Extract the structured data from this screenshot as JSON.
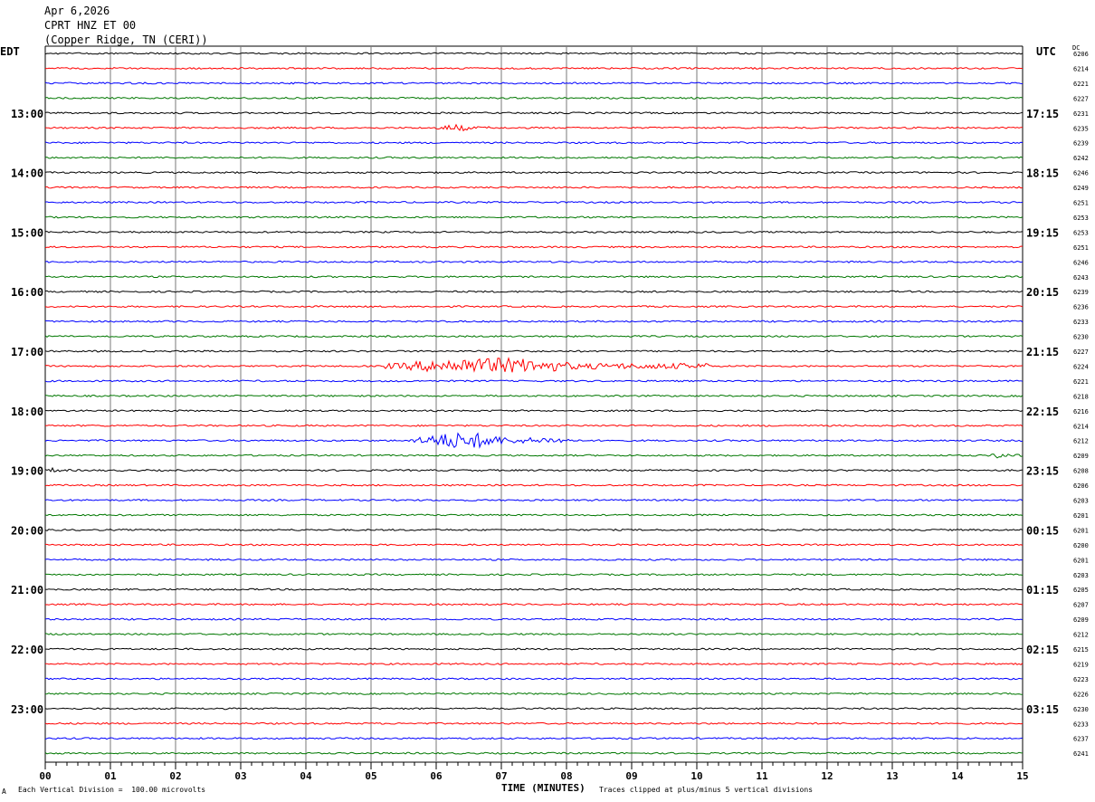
{
  "header": {
    "date": "Apr 6,2026",
    "station": "CPRT HNZ ET 00",
    "location": "(Copper Ridge, TN (CERI))"
  },
  "left_tz": "EDT",
  "right_tz": "UTC",
  "dc_label": "DC",
  "footer": {
    "mark": "A",
    "scale": "Each Vertical Division =  100.00 microvolts",
    "xlabel": "TIME (MINUTES)",
    "clip": "Traces clipped at plus/minus 5 vertical divisions"
  },
  "colors": {
    "cycle": [
      "#000000",
      "#ff0000",
      "#0000ff",
      "#007700"
    ],
    "grid": "#7a7a7a"
  },
  "chart_data": {
    "type": "line",
    "x_ticks": [
      "00",
      "01",
      "02",
      "03",
      "04",
      "05",
      "06",
      "07",
      "08",
      "09",
      "10",
      "11",
      "12",
      "13",
      "14",
      "15"
    ],
    "xlim": [
      0,
      15
    ],
    "left_hour_labels": [
      "13:00",
      "14:00",
      "15:00",
      "16:00",
      "17:00",
      "18:00",
      "19:00",
      "20:00",
      "21:00",
      "22:00",
      "23:00"
    ],
    "right_hour_labels": [
      "17:15",
      "18:15",
      "19:15",
      "20:15",
      "21:15",
      "22:15",
      "23:15",
      "00:15",
      "01:15",
      "02:15",
      "03:15"
    ],
    "dc_values": [
      "6206",
      "6214",
      "6221",
      "6227",
      "6231",
      "6235",
      "6239",
      "6242",
      "6246",
      "6249",
      "6251",
      "6253",
      "6253",
      "6251",
      "6246",
      "6243",
      "6239",
      "6236",
      "6233",
      "6230",
      "6227",
      "6224",
      "6221",
      "6218",
      "6216",
      "6214",
      "6212",
      "6209",
      "6208",
      "6206",
      "6203",
      "6201",
      "6201",
      "6200",
      "6201",
      "6203",
      "6205",
      "6207",
      "6209",
      "6212",
      "6215",
      "6219",
      "6223",
      "6226",
      "6230",
      "6233",
      "6237",
      "6241"
    ],
    "events": [
      {
        "trace": 5,
        "start_min": 6.0,
        "end_min": 6.9,
        "amplitude": 4
      },
      {
        "trace": 21,
        "start_min": 5.2,
        "end_min": 10.2,
        "amplitude": 9
      },
      {
        "trace": 26,
        "start_min": 5.6,
        "end_min": 8.1,
        "amplitude": 9
      },
      {
        "trace": 27,
        "start_min": 14.5,
        "end_min": 15.0,
        "amplitude": 4
      },
      {
        "trace": 28,
        "start_min": 0.0,
        "end_min": 0.5,
        "amplitude": 3
      }
    ]
  }
}
